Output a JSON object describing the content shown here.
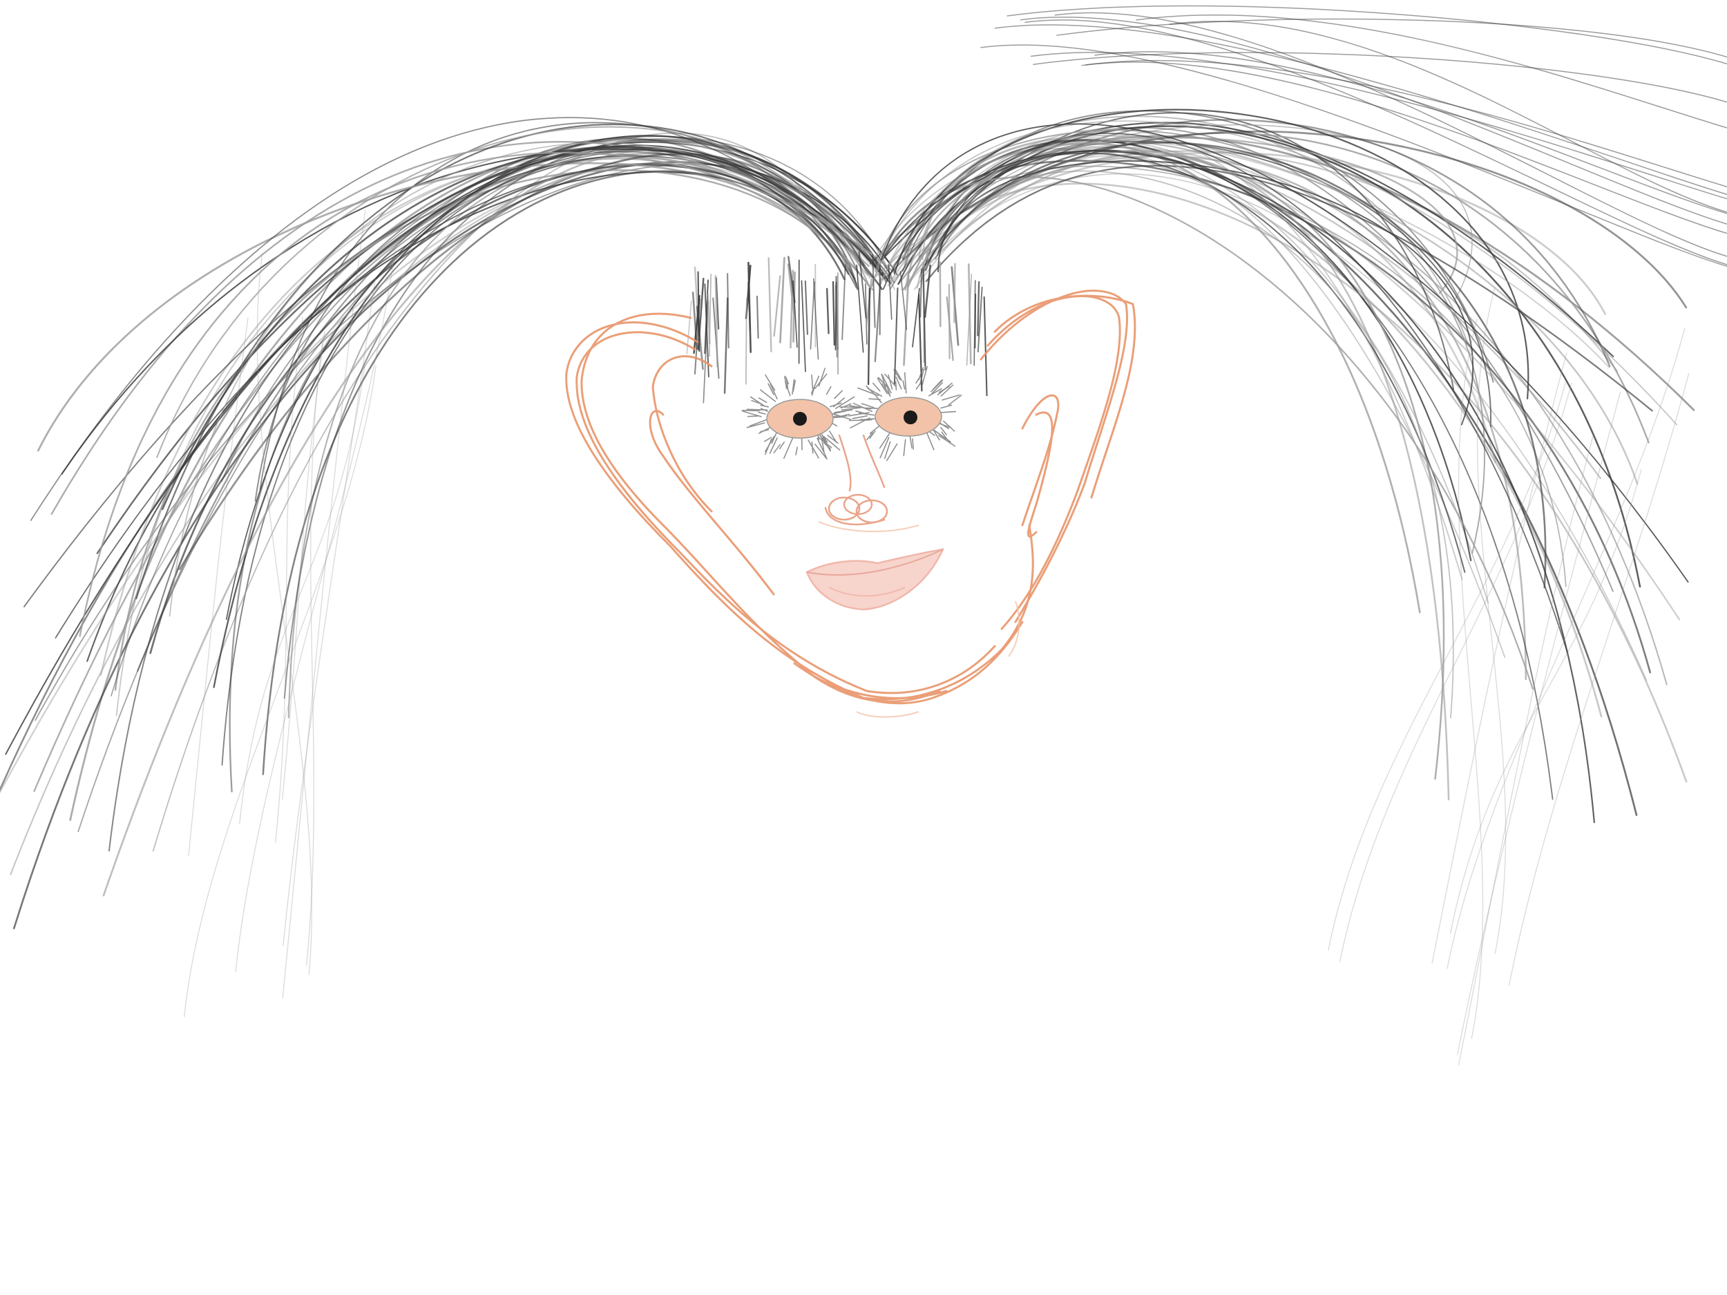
{
  "drawing": {
    "subject": "hand-drawn face",
    "colors": {
      "background": "#ffffff",
      "hair": "#3a3a3a",
      "hair_light": "#9a9a9a",
      "face_outline": "#e8956a",
      "skin_tint": "#f2c3a8",
      "lips": "#f0b7aa",
      "pupil": "#1a1a1a",
      "nose": "#eaa48a"
    },
    "icons": []
  }
}
